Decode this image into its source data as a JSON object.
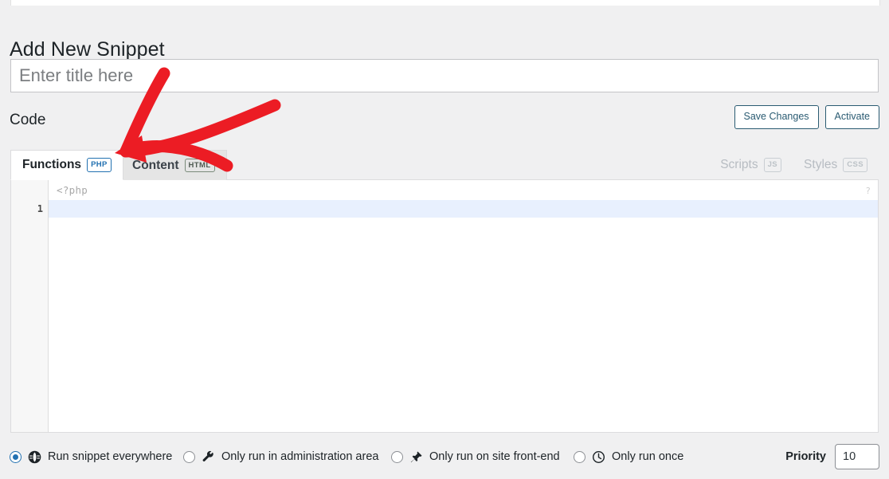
{
  "page": {
    "title": "Add New Snippet"
  },
  "title_field": {
    "value": "",
    "placeholder": "Enter title here"
  },
  "code_section": {
    "heading": "Code",
    "save_label": "Save Changes",
    "activate_label": "Activate"
  },
  "tabs": [
    {
      "label": "Functions",
      "badge": "PHP",
      "state": "active",
      "side": "left"
    },
    {
      "label": "Content",
      "badge": "HTML",
      "state": "inactive",
      "side": "left"
    },
    {
      "label": "Scripts",
      "badge": "JS",
      "state": "disabled",
      "side": "right"
    },
    {
      "label": "Styles",
      "badge": "CSS",
      "state": "disabled",
      "side": "right"
    }
  ],
  "editor": {
    "php_hint": "<?php",
    "line_number": "1",
    "content": "",
    "help_marker": "?"
  },
  "scope_options": [
    {
      "label": "Run snippet everywhere",
      "icon": "globe-icon",
      "checked": true
    },
    {
      "label": "Only run in administration area",
      "icon": "wrench-icon",
      "checked": false
    },
    {
      "label": "Only run on site front-end",
      "icon": "pin-icon",
      "checked": false
    },
    {
      "label": "Only run once",
      "icon": "clock-icon",
      "checked": false
    }
  ],
  "priority": {
    "label": "Priority",
    "value": "10"
  },
  "annotation": {
    "type": "red-arrow",
    "color": "#ec1c24"
  },
  "colors": {
    "page_background": "#f0f0f1",
    "accent_blue": "#2271b1",
    "button_border": "#2a5b72",
    "active_line": "#e8f0fe",
    "annotation_red": "#ec1c24"
  }
}
